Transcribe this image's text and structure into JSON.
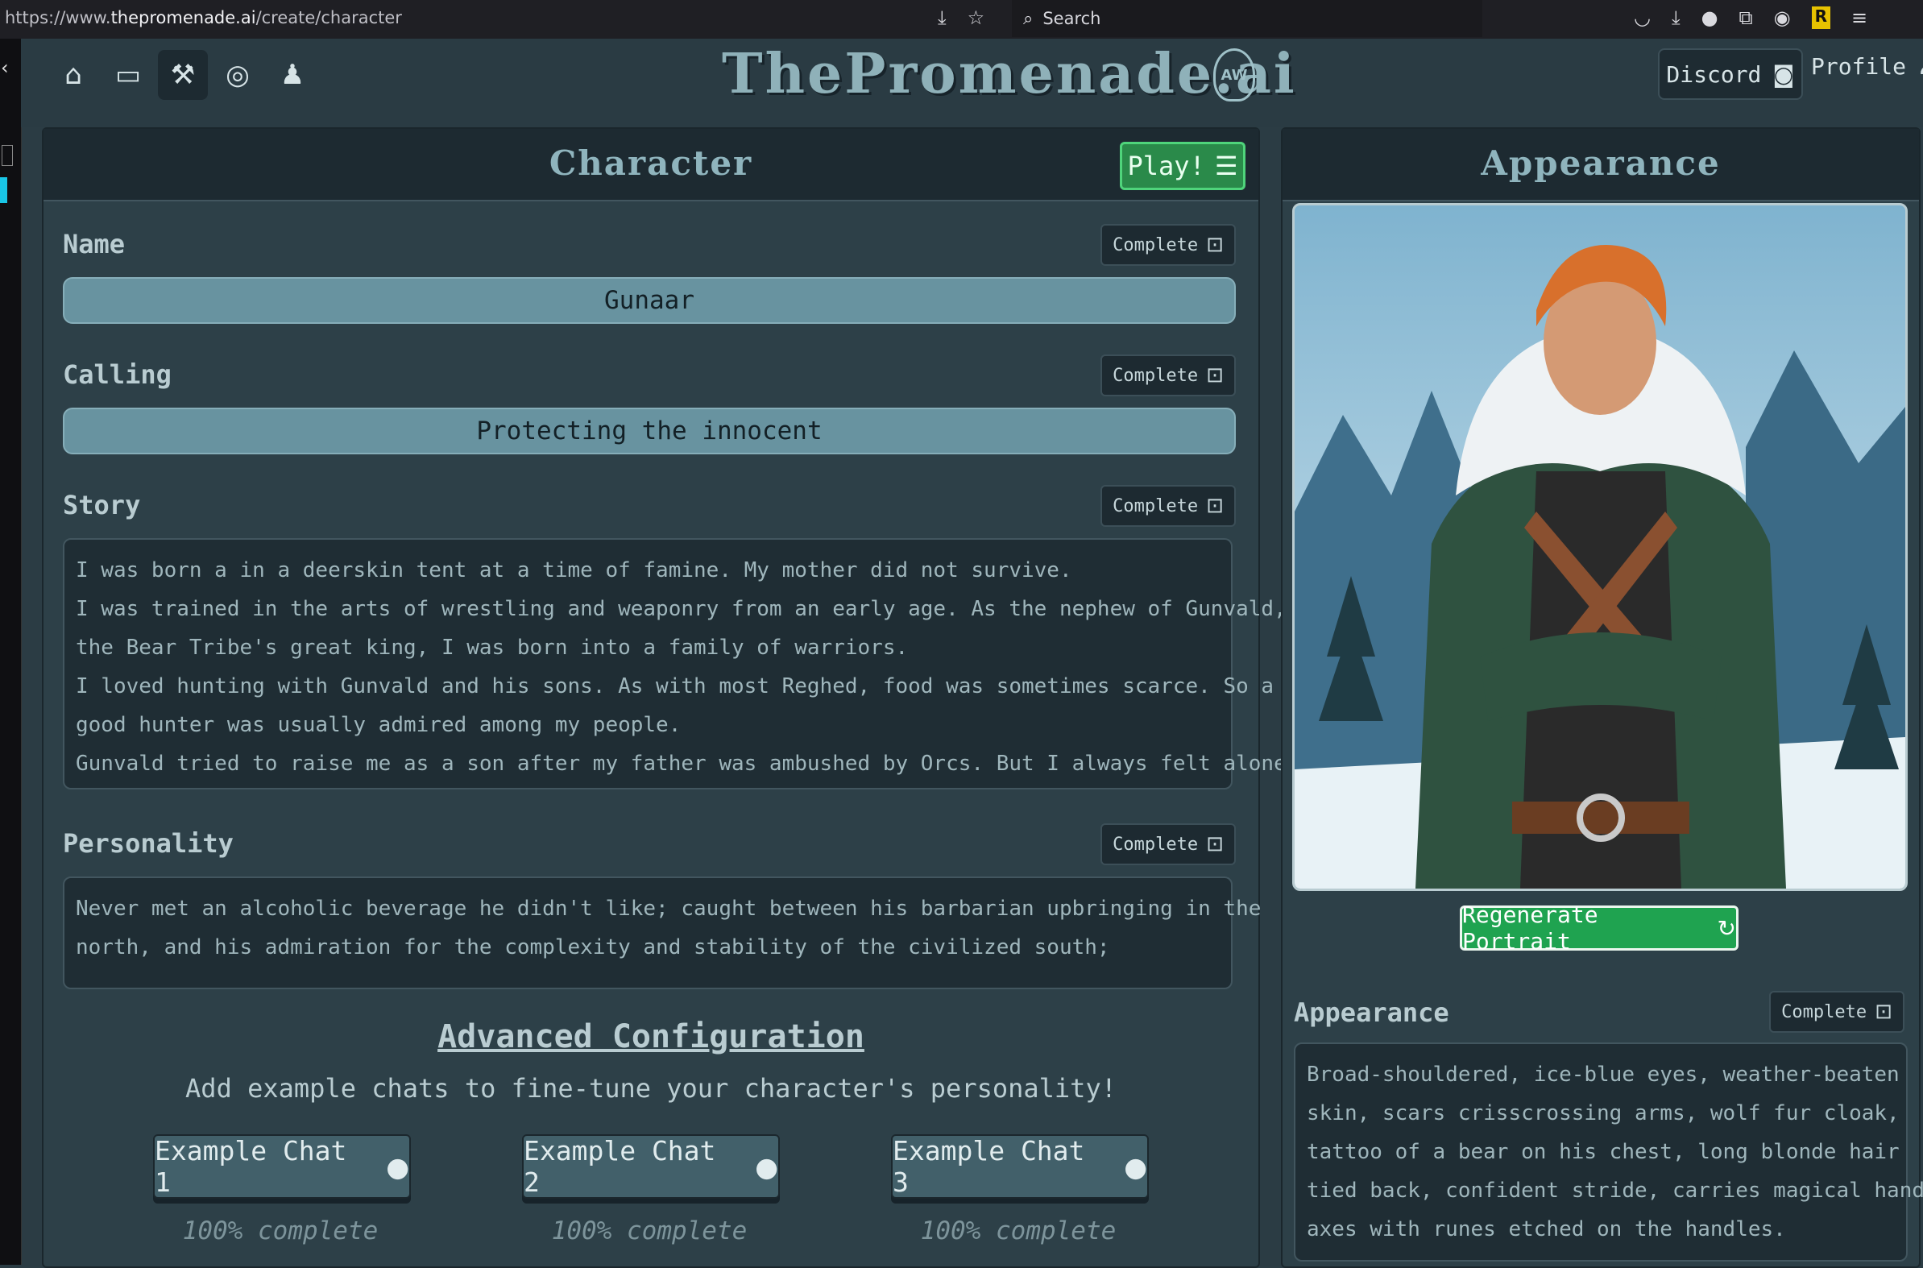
{
  "browser": {
    "url_prefix": "https://www.",
    "url_host": "thepromenade.ai",
    "url_path": "/create/character",
    "search_placeholder": "Search"
  },
  "header": {
    "logo": "ThePromenade.ai",
    "logo_badge": "AW",
    "discord_label": "Discord",
    "profile_label": "Profile"
  },
  "character": {
    "title": "Character",
    "play_label": "Play!",
    "complete_label": "Complete",
    "name_label": "Name",
    "name_value": "Gunaar",
    "calling_label": "Calling",
    "calling_value": "Protecting the innocent",
    "story_label": "Story",
    "story_lines": [
      "I was born a in a deerskin tent at a time of famine. My mother did not survive.",
      "I was trained in the arts of wrestling and weaponry from an early age. As the nephew of Gunvald,",
      "the Bear Tribe's great king, I was born into a family of warriors.",
      "I loved hunting with Gunvald and his sons. As with most Reghed, food was sometimes scarce. So a",
      "good hunter was usually admired among my people.",
      "Gunvald tried to raise me as a son after my father was ambushed by Orcs. But I always felt alone."
    ],
    "personality_label": "Personality",
    "personality_lines": [
      "Never met an alcoholic beverage he didn't like; caught between his barbarian upbringing in the",
      "north, and his admiration for the complexity and stability of the civilized south;"
    ],
    "advanced_title": "Advanced Configuration",
    "advanced_subtitle": "Add example chats to fine-tune your character's personality!",
    "example_chats": [
      {
        "label": "Example Chat 1",
        "progress": "100% complete"
      },
      {
        "label": "Example Chat 2",
        "progress": "100% complete"
      },
      {
        "label": "Example Chat 3",
        "progress": "100% complete"
      }
    ]
  },
  "appearance": {
    "title": "Appearance",
    "regenerate_label": "Regenerate Portrait",
    "field_label": "Appearance",
    "complete_label": "Complete",
    "description_lines": [
      "Broad-shouldered, ice-blue eyes, weather-beaten",
      "skin, scars crisscrossing arms, wolf fur cloak,",
      "tattoo of a bear on his chest, long blonde hair",
      "tied back, confident stride, carries magical hand",
      "axes with runes etched on the handles."
    ]
  },
  "colors": {
    "page_bg": "#2b3c44",
    "panel_header": "#1d2a31",
    "play_green": "#2a8a4a",
    "regen_green": "#1fa350",
    "input_fill": "#6893a0"
  },
  "icons": [
    "home-icon",
    "inbox-icon",
    "hammer-icon",
    "compass-icon",
    "user-upload-icon",
    "discord-icon",
    "profile-icon",
    "robot-icon",
    "menu-icon",
    "chat-bubble-icon",
    "refresh-icon"
  ]
}
